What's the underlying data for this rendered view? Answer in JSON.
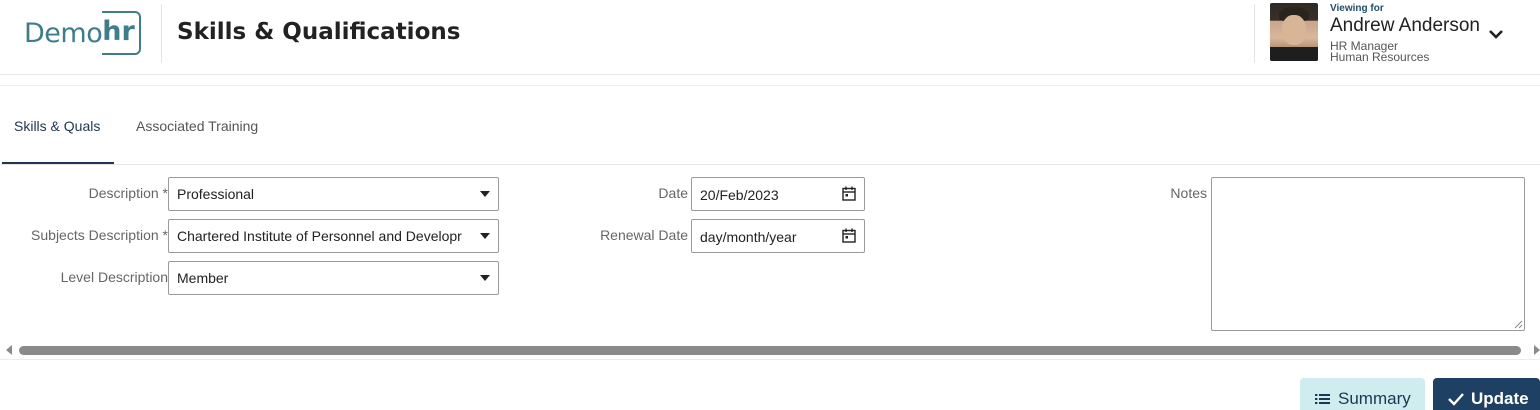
{
  "header": {
    "logo": {
      "part1": "Demo",
      "part2": "hr"
    },
    "title": "Skills & Qualifications",
    "viewing_label": "Viewing for",
    "user": {
      "name": "Andrew Anderson",
      "role": "HR Manager",
      "department": "Human Resources"
    },
    "icons": {
      "dropdown": "chevron-down-icon"
    }
  },
  "tabs": [
    {
      "label": "Skills & Quals",
      "active": true
    },
    {
      "label": "Associated Training",
      "active": false
    }
  ],
  "form": {
    "description": {
      "label": "Description",
      "required_mark": "*",
      "value": "Professional"
    },
    "subjects": {
      "label": "Subjects Description",
      "required_mark": "*",
      "value": "Chartered Institute of Personnel and Developr"
    },
    "level": {
      "label": "Level Description",
      "value": "Member"
    },
    "date": {
      "label": "Date",
      "value": "20/Feb/2023",
      "icon": "calendar-icon"
    },
    "renewal": {
      "label": "Renewal Date",
      "placeholder": "day/month/year",
      "icon": "calendar-icon"
    },
    "notes": {
      "label": "Notes",
      "value": ""
    }
  },
  "actions": {
    "summary_label": "Summary",
    "update_label": "Update",
    "summary_icon": "list-icon",
    "update_icon": "check-icon"
  },
  "colors": {
    "brand": "#3d7e8a",
    "primary": "#1e4062",
    "summary_bg": "#cfecef"
  }
}
